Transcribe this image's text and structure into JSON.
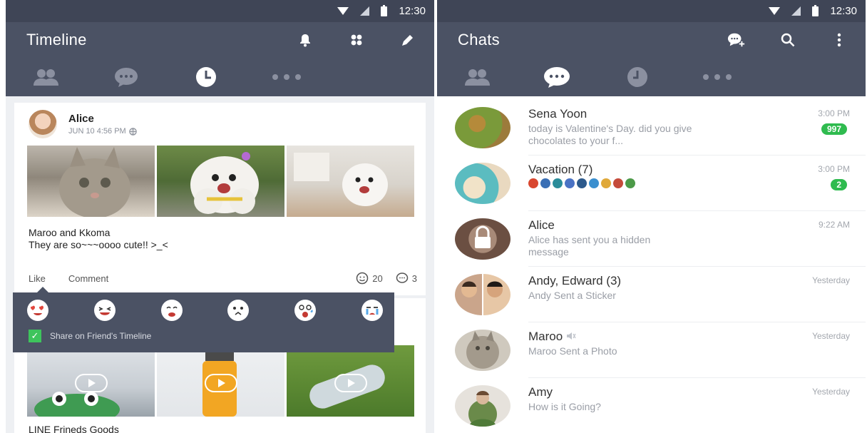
{
  "status": {
    "time": "12:30"
  },
  "left": {
    "title": "Timeline",
    "actions": [
      "bell-icon",
      "apps-icon",
      "pencil-icon"
    ],
    "tabs": [
      "friends-icon",
      "chat-icon",
      "clock-icon",
      "more-icon"
    ],
    "active_tab": 2,
    "post1": {
      "author": "Alice",
      "date": "JUN 10  4:56 PM",
      "caption_line1": "Maroo and Kkoma",
      "caption_line2": "They are so~~~oooo cute!! >_<",
      "like_label": "Like",
      "comment_label": "Comment",
      "smile_count": "20",
      "comment_count": "3"
    },
    "reaction_popup": {
      "share_label": "Share on Friend's Timeline",
      "checked": true
    },
    "post2": {
      "caption": "LINE Frineds Goods"
    }
  },
  "right": {
    "title": "Chats",
    "actions": [
      "add-chat-icon",
      "search-icon",
      "more-vertical-icon"
    ],
    "tabs": [
      "friends-icon",
      "chat-icon",
      "clock-icon",
      "more-icon"
    ],
    "active_tab": 1,
    "chats": [
      {
        "name": "Sena Yoon",
        "msg": "today is Valentine's Day. did you give chocolates to your f...",
        "time": "3:00 PM",
        "badge": "997"
      },
      {
        "name": "Vacation (7)",
        "msg": "",
        "time": "3:00 PM",
        "badge": "2"
      },
      {
        "name": "Alice",
        "msg": "Alice has sent you a hidden message",
        "time": "9:22 AM",
        "badge": ""
      },
      {
        "name": "Andy, Edward (3)",
        "msg": "Andy Sent a Sticker",
        "time": "Yesterday",
        "badge": ""
      },
      {
        "name": "Maroo",
        "msg": "Maroo Sent a Photo",
        "time": "Yesterday",
        "badge": ""
      },
      {
        "name": "Amy",
        "msg": "How is it Going?",
        "time": "Yesterday",
        "badge": ""
      }
    ]
  },
  "colors": {
    "header": "#4b5264",
    "statusbar": "#3f4556",
    "badge": "#2fbb4f"
  }
}
